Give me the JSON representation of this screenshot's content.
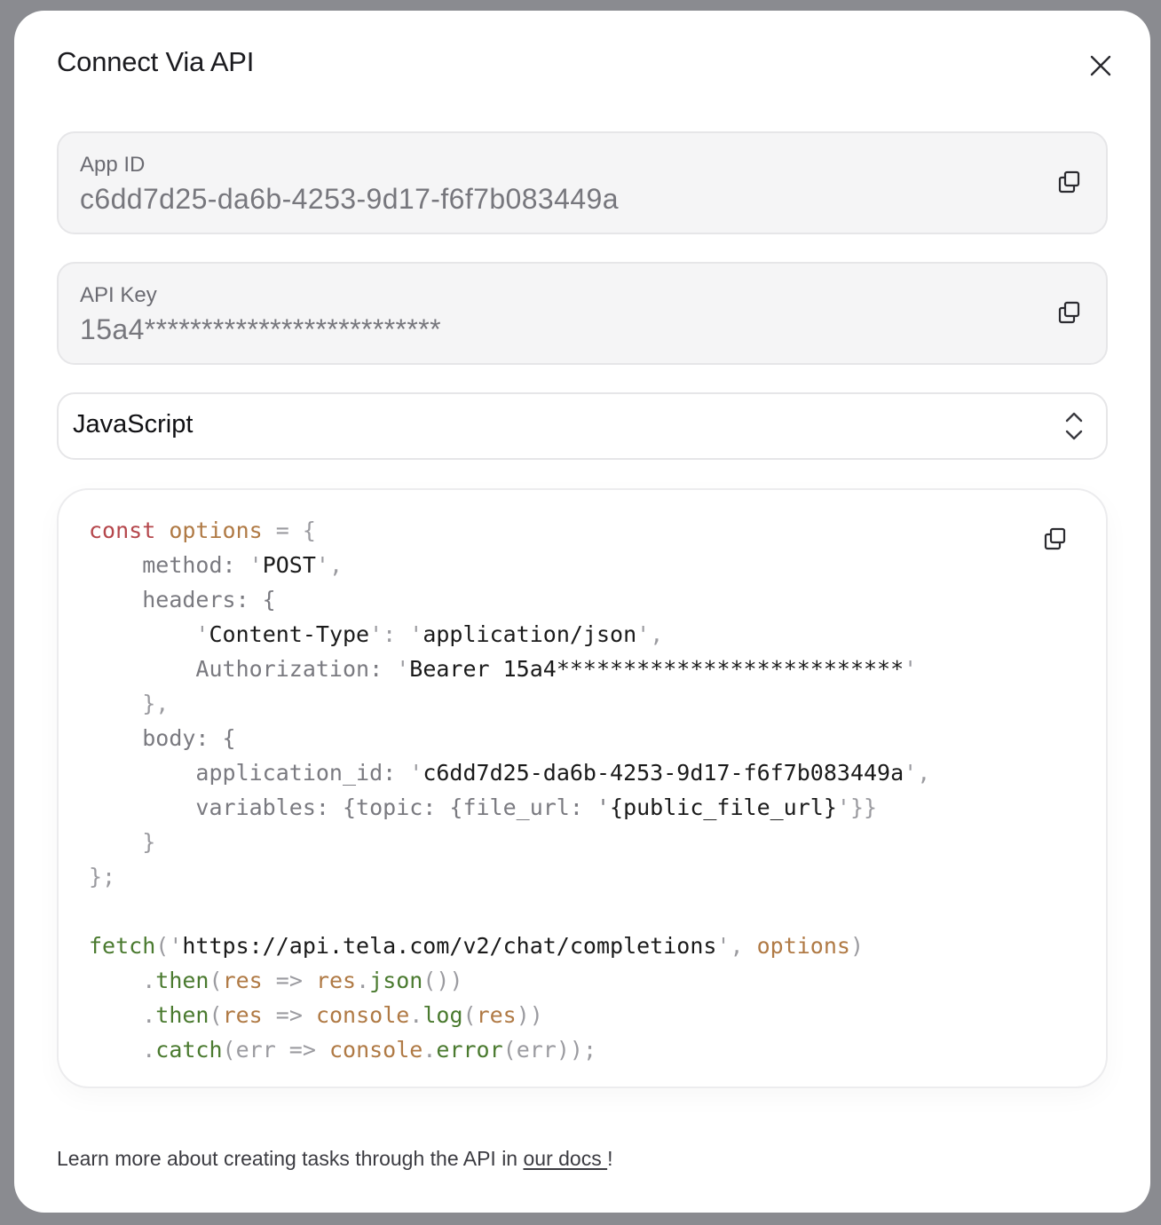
{
  "dialog": {
    "title": "Connect Via API"
  },
  "app_id": {
    "label": "App ID",
    "value": "c6dd7d25-da6b-4253-9d17-f6f7b083449a"
  },
  "api_key": {
    "label": "API Key",
    "value": "15a4**************************"
  },
  "language_select": {
    "selected": "JavaScript"
  },
  "code": {
    "c1": "const",
    "c2": "options",
    "c3": " = {",
    "c4": "method: ",
    "c5": "'",
    "c6": "POST",
    "c7": "',",
    "c8": "headers: {",
    "c9": "'",
    "c10": "Content-Type",
    "c11": "': '",
    "c12": "application/json",
    "c13": "',",
    "c14": "Authorization: ",
    "c15": "'",
    "c16": "Bearer 15a4**************************",
    "c17": "'",
    "c18": "},",
    "c19": "body: {",
    "c20": "application_id: ",
    "c21": "'",
    "c22": "c6dd7d25-da6b-4253-9d17-f6f7b083449a",
    "c23": "',",
    "c24": "variables: {topic: {file_url: '",
    "c25": "{public_file_url}",
    "c26": "'}}",
    "c27": "}",
    "c28": "};",
    "c29": "fetch",
    "c30": "('",
    "c31": "https://api.tela.com/v2/chat/completions",
    "c32": "', ",
    "c33": "options",
    "c34": ")",
    "c35": ".",
    "c36": "then",
    "c37": "(",
    "c38": "res",
    "c39": " => ",
    "c40": "res",
    "c41": ".",
    "c42": "json",
    "c43": "())",
    "c44": ".",
    "c45": "then",
    "c46": "(",
    "c47": "res",
    "c48": " => ",
    "c49": "console",
    "c50": ".",
    "c51": "log",
    "c52": "(",
    "c53": "res",
    "c54": "))",
    "c55": ".",
    "c56": "catch",
    "c57": "(err => ",
    "c58": "console",
    "c59": ".",
    "c60": "error",
    "c61": "(err));"
  },
  "footer": {
    "text": "Learn more about creating tasks through the API in ",
    "link": "our docs ",
    "suffix": "!"
  },
  "icons": {
    "close": "close-icon",
    "copy": "copy-icon",
    "chevrons": "chevron-up-down-icon"
  },
  "colors": {
    "keyword": "#b5474c",
    "variable": "#b07a45",
    "function": "#4a7a2f",
    "punctuation": "#9b9ba0",
    "property": "#7a7a80"
  }
}
